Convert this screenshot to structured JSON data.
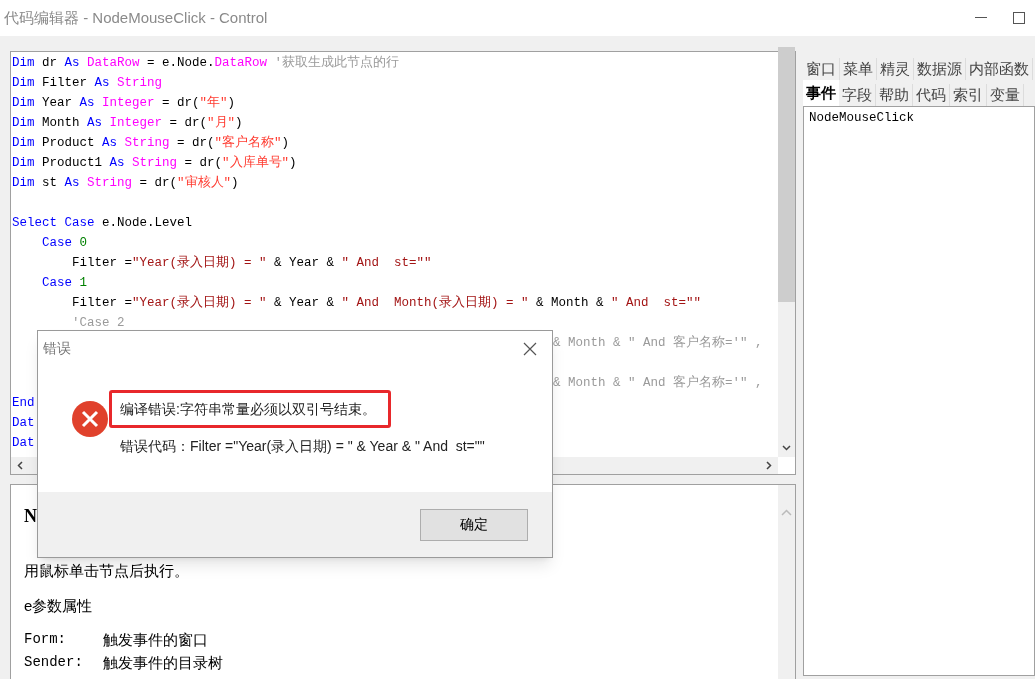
{
  "window": {
    "title": "代码编辑器 - NodeMouseClick - Control"
  },
  "code_editor": {
    "lines": [
      {
        "kind": "code",
        "tokens": [
          {
            "kind": "kw",
            "text": "Dim"
          },
          {
            "kind": "plain",
            "text": " dr "
          },
          {
            "kind": "kw",
            "text": "As"
          },
          {
            "kind": "type",
            "text": " DataRow"
          },
          {
            "kind": "plain",
            "text": " = e.Node."
          },
          {
            "kind": "type",
            "text": "DataRow"
          },
          {
            "kind": "comment",
            "text": " '获取生成此节点的行"
          }
        ]
      },
      {
        "kind": "code",
        "tokens": [
          {
            "kind": "kw",
            "text": "Dim"
          },
          {
            "kind": "plain",
            "text": " Filter "
          },
          {
            "kind": "kw",
            "text": "As"
          },
          {
            "kind": "type",
            "text": " String"
          }
        ]
      },
      {
        "kind": "code",
        "tokens": [
          {
            "kind": "kw",
            "text": "Dim"
          },
          {
            "kind": "plain",
            "text": " Year "
          },
          {
            "kind": "kw",
            "text": "As"
          },
          {
            "kind": "type",
            "text": " Integer"
          },
          {
            "kind": "plain",
            "text": " = dr("
          },
          {
            "kind": "string",
            "text": "\"年\""
          },
          {
            "kind": "plain",
            "text": ")"
          }
        ]
      },
      {
        "kind": "code",
        "tokens": [
          {
            "kind": "kw",
            "text": "Dim"
          },
          {
            "kind": "plain",
            "text": " Month "
          },
          {
            "kind": "kw",
            "text": "As"
          },
          {
            "kind": "type",
            "text": " Integer"
          },
          {
            "kind": "plain",
            "text": " = dr("
          },
          {
            "kind": "string",
            "text": "\"月\""
          },
          {
            "kind": "plain",
            "text": ")"
          }
        ]
      },
      {
        "kind": "code",
        "tokens": [
          {
            "kind": "kw",
            "text": "Dim"
          },
          {
            "kind": "plain",
            "text": " Product "
          },
          {
            "kind": "kw",
            "text": "As"
          },
          {
            "kind": "type",
            "text": " String"
          },
          {
            "kind": "plain",
            "text": " = dr("
          },
          {
            "kind": "string",
            "text": "\"客户名称\""
          },
          {
            "kind": "plain",
            "text": ")"
          }
        ]
      },
      {
        "kind": "code",
        "tokens": [
          {
            "kind": "kw",
            "text": "Dim"
          },
          {
            "kind": "plain",
            "text": " Product1 "
          },
          {
            "kind": "kw",
            "text": "As"
          },
          {
            "kind": "type",
            "text": " String"
          },
          {
            "kind": "plain",
            "text": " = dr("
          },
          {
            "kind": "string",
            "text": "\"入库单号\""
          },
          {
            "kind": "plain",
            "text": ")"
          }
        ]
      },
      {
        "kind": "code",
        "tokens": [
          {
            "kind": "kw",
            "text": "Dim"
          },
          {
            "kind": "plain",
            "text": " st "
          },
          {
            "kind": "kw",
            "text": "As"
          },
          {
            "kind": "type",
            "text": " String"
          },
          {
            "kind": "plain",
            "text": " = dr("
          },
          {
            "kind": "string",
            "text": "\"审核人\""
          },
          {
            "kind": "plain",
            "text": ")"
          }
        ]
      },
      {
        "kind": "blank"
      },
      {
        "kind": "code",
        "tokens": [
          {
            "kind": "kw",
            "text": "Select Case"
          },
          {
            "kind": "plain",
            "text": " e.Node.Level"
          }
        ]
      },
      {
        "kind": "code",
        "tokens": [
          {
            "kind": "kw",
            "text": "    Case"
          },
          {
            "kind": "number",
            "text": " 0"
          }
        ]
      },
      {
        "kind": "code",
        "tokens": [
          {
            "kind": "plain",
            "text": "        Filter ="
          },
          {
            "kind": "literal",
            "text": "\"Year(录入日期) = \""
          },
          {
            "kind": "plain",
            "text": " & Year & "
          },
          {
            "kind": "literal",
            "text": "\" And  st=\"\""
          }
        ]
      },
      {
        "kind": "code",
        "tokens": [
          {
            "kind": "kw",
            "text": "    Case"
          },
          {
            "kind": "number",
            "text": " 1"
          }
        ]
      },
      {
        "kind": "code",
        "tokens": [
          {
            "kind": "plain",
            "text": "        Filter ="
          },
          {
            "kind": "literal",
            "text": "\"Year(录入日期) = \""
          },
          {
            "kind": "plain",
            "text": " & Year & "
          },
          {
            "kind": "literal",
            "text": "\" And  Month(录入日期) = \""
          },
          {
            "kind": "plain",
            "text": " & Month & "
          },
          {
            "kind": "literal",
            "text": "\" And  st=\"\""
          }
        ]
      },
      {
        "kind": "code",
        "tokens": [
          {
            "kind": "comment",
            "text": "        'Case 2"
          }
        ]
      },
      {
        "kind": "fragment",
        "tokens": [
          {
            "kind": "comment",
            "text": "& Month & \" And 客户名称='\" ,"
          }
        ]
      },
      {
        "kind": "blank"
      },
      {
        "kind": "fragment",
        "tokens": [
          {
            "kind": "comment",
            "text": "& Month & \" And 客户名称='\" ,"
          }
        ]
      },
      {
        "kind": "code",
        "tokens": [
          {
            "kind": "kw",
            "text": "End"
          }
        ]
      },
      {
        "kind": "code",
        "tokens": [
          {
            "kind": "kw",
            "text": "Dat"
          }
        ]
      },
      {
        "kind": "code",
        "tokens": [
          {
            "kind": "kw",
            "text": "Dat"
          }
        ]
      }
    ]
  },
  "help_panel": {
    "heading": "N",
    "paragraphs": [
      {
        "kind": "text",
        "text": "用鼠标单击节点后执行。"
      },
      {
        "kind": "text",
        "text": "e参数属性"
      },
      {
        "kind": "prop",
        "name": "Form:",
        "text": "触发事件的窗口"
      },
      {
        "kind": "prop",
        "name": "Sender:",
        "text": "触发事件的目录树"
      }
    ]
  },
  "side_panel": {
    "tab_rows": [
      [
        {
          "label": "窗口",
          "selected": false
        },
        {
          "label": "菜单",
          "selected": false
        },
        {
          "label": "精灵",
          "selected": false
        },
        {
          "label": "数据源",
          "selected": false
        },
        {
          "label": "内部函数",
          "selected": false
        }
      ],
      [
        {
          "label": "事件",
          "selected": true
        },
        {
          "label": "字段",
          "selected": false
        },
        {
          "label": "帮助",
          "selected": false
        },
        {
          "label": "代码",
          "selected": false
        },
        {
          "label": "索引",
          "selected": false
        },
        {
          "label": "变量",
          "selected": false
        }
      ]
    ],
    "items": [
      "NodeMouseClick"
    ]
  },
  "dialog": {
    "title": "错误",
    "message": "编译错误:字符串常量必须以双引号结束。",
    "detail": "错误代码：Filter =\"Year(录入日期) = \" & Year & \" And  st=\"\"",
    "button": "确定"
  }
}
